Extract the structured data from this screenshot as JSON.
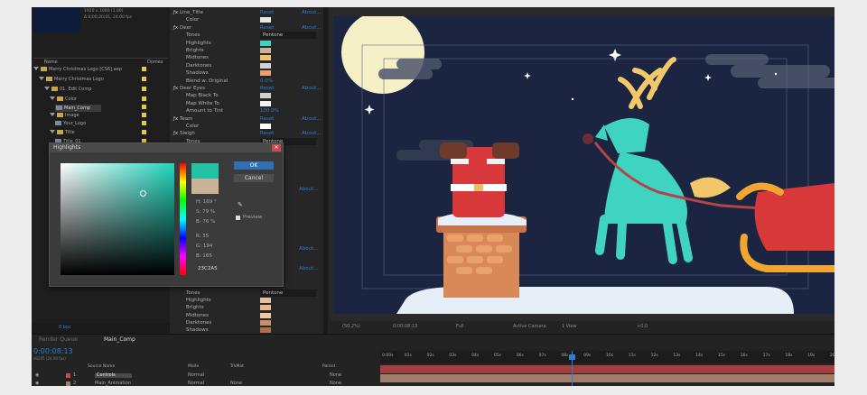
{
  "project": {
    "info_line1": "1920 x 1080 (1.00)",
    "info_line2": "Δ 0;00;20;01, 24.00 fps",
    "col_name": "Name",
    "col_label": "Domes",
    "tree": [
      {
        "label": "Merry Christmas Logo [CS6].aep",
        "type": "folder"
      },
      {
        "label": "Merry Christmas Logo",
        "type": "folder"
      },
      {
        "label": "01. Edit Comp",
        "type": "folder"
      },
      {
        "label": "Color",
        "type": "folder"
      },
      {
        "label": "Main_Comp",
        "type": "comp",
        "selected": true
      },
      {
        "label": "Image",
        "type": "folder"
      },
      {
        "label": "Your_Logo",
        "type": "comp"
      },
      {
        "label": "Title",
        "type": "folder"
      },
      {
        "label": "Title_01",
        "type": "comp"
      }
    ],
    "bpc": "8 bpc"
  },
  "effects": {
    "rows": [
      {
        "indent": 0,
        "label": "Line_Title",
        "link": "Reset",
        "about": "About..."
      },
      {
        "indent": 1,
        "label": "Color",
        "swatch": "#e8e8e8"
      },
      {
        "indent": 0,
        "label": "Deer",
        "link": "Reset",
        "about": "About..."
      },
      {
        "indent": 1,
        "label": "Tones",
        "dropdown": "Pentone"
      },
      {
        "indent": 1,
        "label": "Highlights",
        "swatch": "#3fd4c2"
      },
      {
        "indent": 1,
        "label": "Brights",
        "swatch": "#cbb39a"
      },
      {
        "indent": 1,
        "label": "Midtones",
        "swatch": "#f0c070"
      },
      {
        "indent": 1,
        "label": "Darktones",
        "swatch": "#d4d4d4"
      },
      {
        "indent": 1,
        "label": "Shadows",
        "swatch": "#e8a070"
      },
      {
        "indent": 1,
        "label": "Blend w. Original",
        "value": "0.0%"
      },
      {
        "indent": 0,
        "label": "Deer Eyes",
        "link": "Reset",
        "about": "About..."
      },
      {
        "indent": 1,
        "label": "Map Black To",
        "swatch": "#cfcfcf"
      },
      {
        "indent": 1,
        "label": "Map White To",
        "swatch": "#f2f2f2"
      },
      {
        "indent": 1,
        "label": "Amount to Tint",
        "value": "100.0%"
      },
      {
        "indent": 0,
        "label": "Team",
        "link": "Reset",
        "about": "About..."
      },
      {
        "indent": 1,
        "label": "Color",
        "swatch": "#ffffff"
      },
      {
        "indent": 0,
        "label": "Sleigh",
        "link": "Reset",
        "about": "About..."
      },
      {
        "indent": 1,
        "label": "Tones",
        "dropdown": "Pentone"
      }
    ],
    "lower_rows": [
      {
        "label": "Tones",
        "dropdown": "Pentone"
      },
      {
        "label": "Highlights",
        "swatch": "#e0c0a0"
      },
      {
        "label": "Brights",
        "swatch": "#e8b890"
      },
      {
        "label": "Midtones",
        "swatch": "#f0c8a0"
      },
      {
        "label": "Darktones",
        "swatch": "#c8906a"
      },
      {
        "label": "Shadows",
        "swatch": "#b07050"
      }
    ],
    "about_side": [
      "About...",
      "About...",
      "About..."
    ]
  },
  "picker": {
    "title": "Highlights",
    "ok": "OK",
    "cancel": "Cancel",
    "current_color": "#23c2a5",
    "original_color": "#cbb39a",
    "h": "H: 169 °",
    "s": "S: 79 %",
    "b": "B: 76 %",
    "r": "R: 35",
    "g": "G: 194",
    "b2": "B: 165",
    "hex": "23C2A5",
    "preview": "Preview"
  },
  "viewer": {
    "zoom": "(50.2%)",
    "time": "0:00:08:13",
    "resolution": "Full",
    "camera": "Active Camera",
    "view": "1 View",
    "exposure": "+0.0"
  },
  "timeline": {
    "tab_render": "Render Queue",
    "tab_comp": "Main_Comp",
    "timecode": "0:00:08:13",
    "fps_line": "00205 (24.00 fps)",
    "col_source": "Source Name",
    "col_mode": "Mode",
    "col_trkmat": "TrkMat",
    "col_parent": "Parent",
    "layers": [
      {
        "num": "1",
        "name": "Controls",
        "mode": "Normal",
        "trkmat": "",
        "parent": "None"
      },
      {
        "num": "2",
        "name": "Main_Animation",
        "mode": "Normal",
        "trkmat": "None",
        "parent": "None"
      }
    ],
    "ruler": [
      "0:00s",
      "01s",
      "02s",
      "03s",
      "04s",
      "05s",
      "06s",
      "07s",
      "08s",
      "09s",
      "10s",
      "11s",
      "12s",
      "13s",
      "14s",
      "15s",
      "16s",
      "17s",
      "18s",
      "19s",
      "20s"
    ]
  },
  "colors": {
    "canvas_bg": "#1b2541",
    "accent_teal": "#3fd4c2",
    "santa_red": "#d8383a",
    "sleigh_orange": "#f2a531"
  }
}
